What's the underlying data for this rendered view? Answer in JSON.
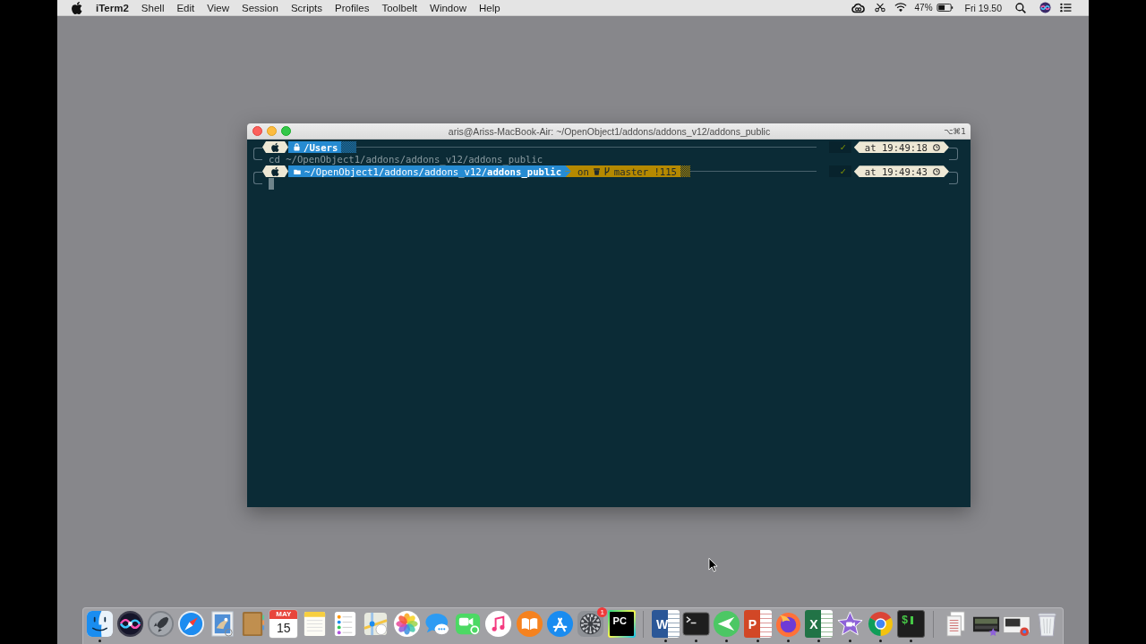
{
  "menu_bar": {
    "app_name": "iTerm2",
    "menus": [
      "Shell",
      "Edit",
      "View",
      "Session",
      "Scripts",
      "Profiles",
      "Toolbelt",
      "Window",
      "Help"
    ],
    "battery_percent": "47%",
    "clock": "Fri 19.50"
  },
  "window": {
    "title": "aris@Ariss-MacBook-Air: ~/OpenObject1/addons/addons_v12/addons_public",
    "shortcut": "⌥⌘1",
    "prompts": [
      {
        "locked": true,
        "path_leaf": "/Users",
        "exit_status": "✓",
        "time": "at 19:49:18",
        "command": "cd ~/OpenObject1/addons/addons_v12/addons_public",
        "cursor": false
      },
      {
        "locked": false,
        "path_parent": "~/OpenObject1/addons/addons_v12/",
        "path_leaf": "addons_public",
        "vcs": {
          "prefix": "on",
          "branch": "master !115"
        },
        "exit_status": "✓",
        "time": "at 19:49:43",
        "cursor": true
      }
    ]
  },
  "dock": {
    "sections": [
      {
        "items": [
          {
            "kind": "face",
            "running": true
          },
          {
            "kind": "orb",
            "running": false
          },
          {
            "kind": "rocket",
            "running": false
          },
          {
            "kind": "compass",
            "running": false
          },
          {
            "kind": "stamp",
            "running": false
          },
          {
            "kind": "notebook",
            "running": false
          },
          {
            "kind": "calendar",
            "month": "MAY",
            "day": "15",
            "running": false
          },
          {
            "kind": "notepad",
            "running": false
          },
          {
            "kind": "checklist",
            "running": false
          },
          {
            "kind": "map",
            "running": false
          },
          {
            "kind": "flower",
            "running": false
          },
          {
            "kind": "bubble",
            "running": false
          },
          {
            "kind": "camera",
            "running": false
          },
          {
            "kind": "note",
            "running": false
          },
          {
            "kind": "book",
            "running": false
          },
          {
            "kind": "astore",
            "running": false
          },
          {
            "kind": "gear",
            "badge": "1",
            "running": false
          },
          {
            "kind": "pc",
            "glyph": "PC",
            "running": false
          }
        ]
      },
      {
        "items": [
          {
            "kind": "word",
            "glyph": "W",
            "running": true
          },
          {
            "kind": "terminal",
            "running": true
          },
          {
            "kind": "plane",
            "running": true
          },
          {
            "kind": "slides",
            "glyph": "P",
            "running": true
          },
          {
            "kind": "foxglobe",
            "running": true
          },
          {
            "kind": "sheet",
            "glyph": "X",
            "running": true
          },
          {
            "kind": "star",
            "running": true
          },
          {
            "kind": "ring",
            "running": true
          },
          {
            "kind": "shell",
            "glyph": "$",
            "running": true
          }
        ]
      },
      {
        "items": [
          {
            "kind": "docs",
            "running": false
          },
          {
            "kind": "videothumb",
            "running": false
          },
          {
            "kind": "webthumb",
            "running": false
          },
          {
            "kind": "trash",
            "running": false
          }
        ]
      }
    ]
  }
}
